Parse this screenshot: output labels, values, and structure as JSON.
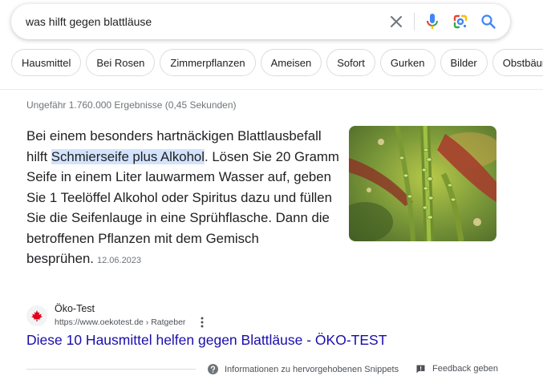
{
  "search": {
    "query": "was hilft gegen blattläuse",
    "clear_icon": "close-icon",
    "voice_icon": "microphone-icon",
    "lens_icon": "google-lens-icon",
    "search_icon": "search-icon"
  },
  "chips": [
    "Hausmittel",
    "Bei Rosen",
    "Zimmerpflanzen",
    "Ameisen",
    "Sofort",
    "Gurken",
    "Bilder",
    "Obstbäume"
  ],
  "result_stats": "Ungefähr 1.760.000 Ergebnisse (0,45 Sekunden)",
  "featured_snippet": {
    "text_before": "Bei einem besonders hartnäckigen Blattlausbefall hilft ",
    "highlight": "Schmierseife plus Alkohol",
    "text_after": ". Lösen Sie 20 Gramm Seife in einem Liter lauwarmem Wasser auf, geben Sie 1 Teelöffel Alkohol oder Spiritus dazu und füllen Sie die Seifenlauge in eine Sprühflasche. Dann die betroffenen Pflanzen mit dem Gemisch besprühen.",
    "date": "12.06.2023",
    "image": "aphids-on-rose-stem-photo"
  },
  "source": {
    "name": "Öko-Test",
    "url": "https://www.oekotest.de › Ratgeber",
    "logo_icon": "maple-leaf-icon",
    "menu_icon": "more-vert-icon",
    "title": "Diese 10 Hausmittel helfen gegen Blattläuse - ÖKO-TEST"
  },
  "footer": {
    "info_label": "Informationen zu hervorgehobenen Snippets",
    "info_icon": "help-circle-icon",
    "feedback_label": "Feedback geben",
    "feedback_icon": "feedback-icon"
  },
  "colors": {
    "link": "#1a0dab",
    "highlight": "#d3e3fd",
    "logo_red": "#e2001a",
    "muted": "#70757a"
  }
}
